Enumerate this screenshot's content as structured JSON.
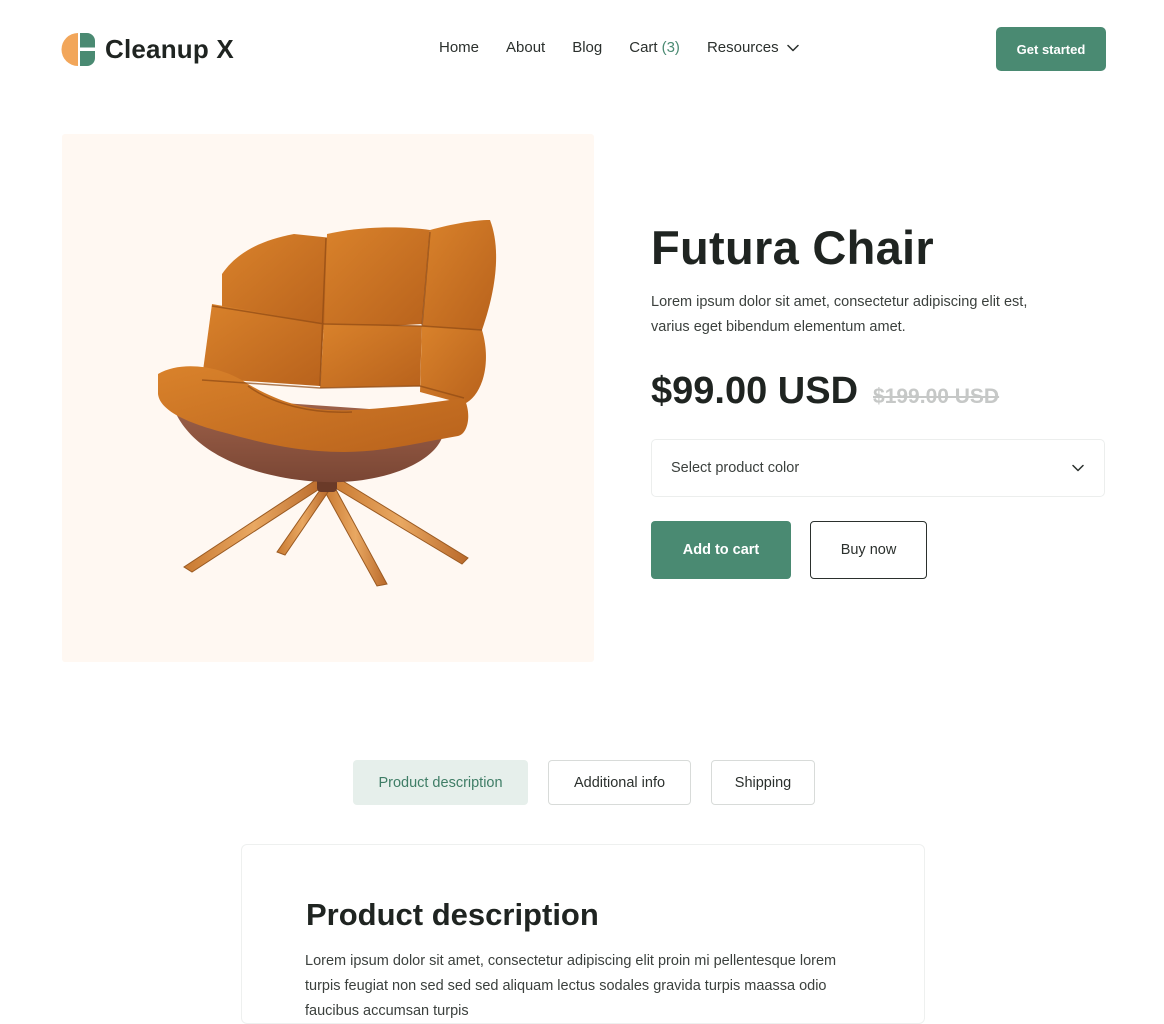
{
  "brand": {
    "name": "Cleanup X",
    "logo_colors": {
      "left": "#f2a65a",
      "right": "#4a8a72"
    }
  },
  "nav": {
    "home": "Home",
    "about": "About",
    "blog": "Blog",
    "cart_label": "Cart",
    "cart_count": "(3)",
    "resources": "Resources",
    "resources_icon": "chevron-down-icon"
  },
  "header": {
    "cta_label": "Get started"
  },
  "product": {
    "title": "Futura Chair",
    "description": "Lorem ipsum dolor sit amet, consectetur adipiscing elit est, varius eget bibendum elementum amet.",
    "price": "$99.00 USD",
    "old_price": "$199.00 USD",
    "color_select_placeholder": "Select product color",
    "add_to_cart_label": "Add to cart",
    "buy_now_label": "Buy now"
  },
  "tabs": [
    {
      "label": "Product description",
      "active": true
    },
    {
      "label": "Additional info",
      "active": false
    },
    {
      "label": "Shipping",
      "active": false
    }
  ],
  "description_section": {
    "heading": "Product description",
    "body": "Lorem ipsum dolor sit amet, consectetur adipiscing elit proin mi pellentesque  lorem turpis feugiat non sed sed sed aliquam lectus sodales gravida turpis maassa odio faucibus accumsan turpis"
  },
  "colors": {
    "accent": "#4a8a72",
    "accent_soft": "#e6efeb",
    "image_background": "#fff8f2",
    "text": "#1f2421",
    "old_price": "#c6c8c7"
  }
}
